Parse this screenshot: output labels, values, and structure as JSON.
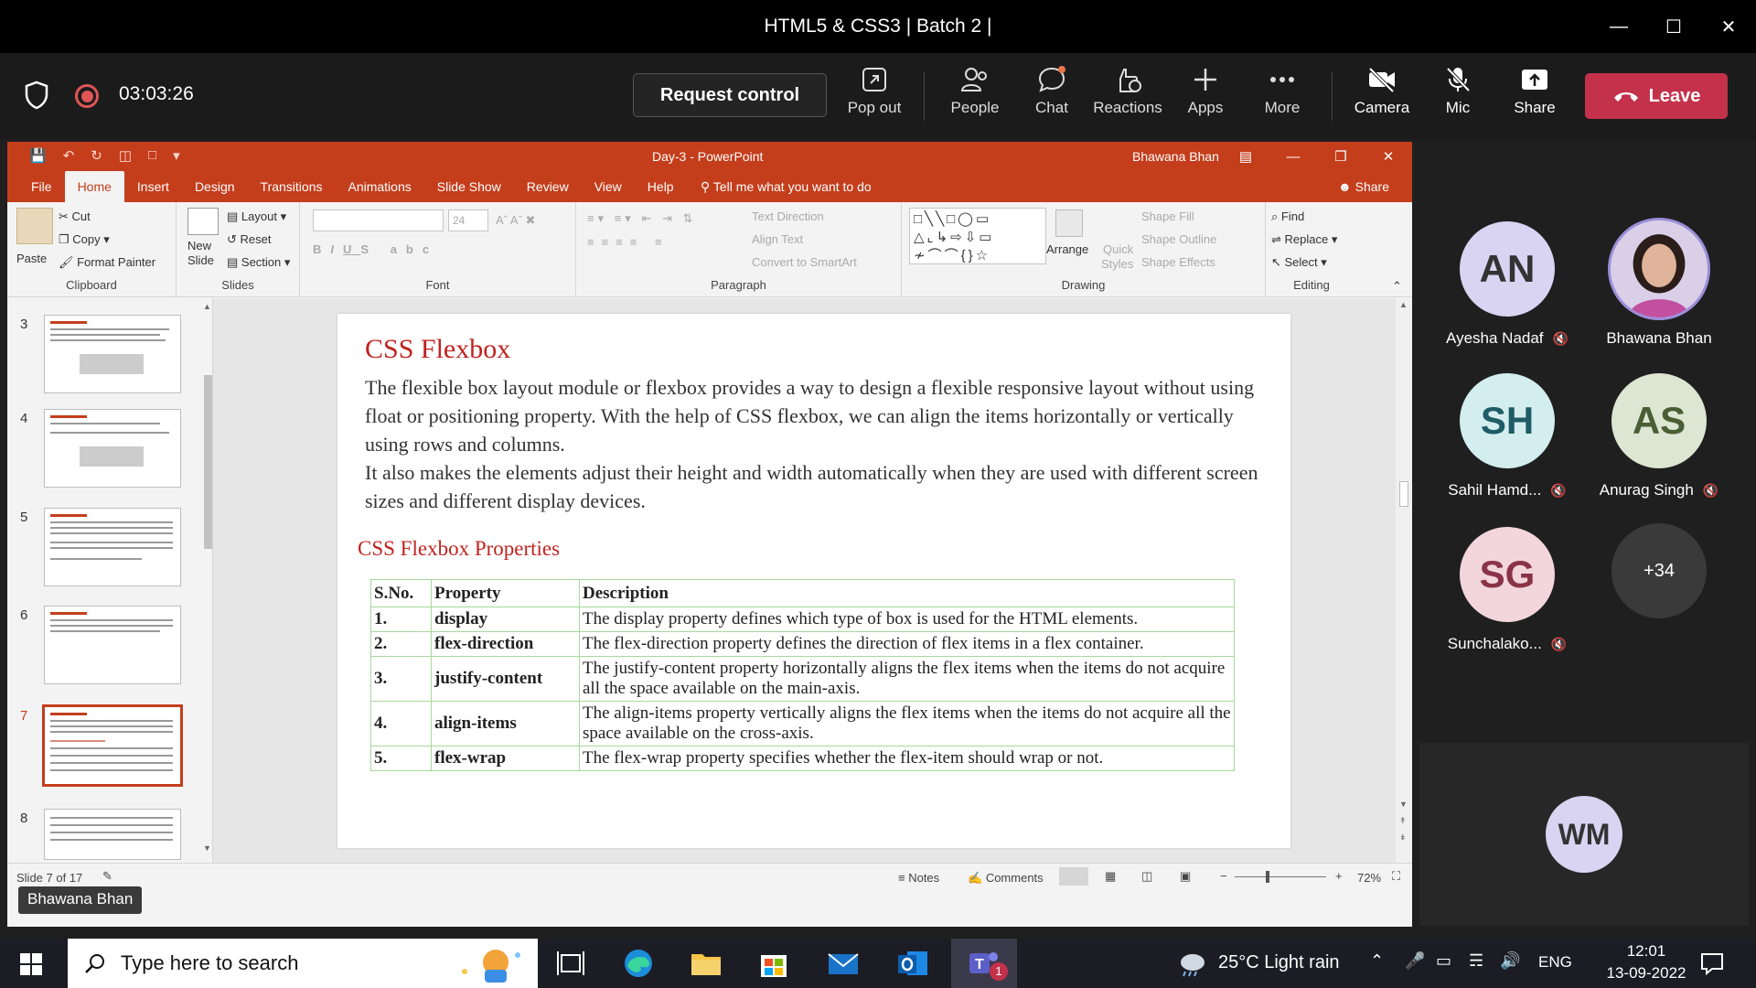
{
  "teams": {
    "window_title": "HTML5 & CSS3 | Batch 2 |",
    "timer": "03:03:26",
    "request_control": "Request control",
    "tools": [
      {
        "label": "Pop out",
        "icon": "pop-out-icon"
      },
      {
        "label": "People",
        "icon": "people-icon"
      },
      {
        "label": "Chat",
        "icon": "chat-icon"
      },
      {
        "label": "Reactions",
        "icon": "reactions-icon"
      },
      {
        "label": "Apps",
        "icon": "apps-icon"
      },
      {
        "label": "More",
        "icon": "more-icon"
      },
      {
        "label": "Camera",
        "icon": "camera-off-icon"
      },
      {
        "label": "Mic",
        "icon": "mic-off-icon"
      },
      {
        "label": "Share",
        "icon": "share-icon"
      }
    ],
    "leave": "Leave",
    "colors": {
      "leave": "#c4314b",
      "recording": "#e05555"
    }
  },
  "ppt": {
    "title": "Day-3 - PowerPoint",
    "user": "Bhawana Bhan",
    "tabs": [
      "File",
      "Home",
      "Insert",
      "Design",
      "Transitions",
      "Animations",
      "Slide Show",
      "Review",
      "View",
      "Help"
    ],
    "tell_me": "Tell me what you want to do",
    "share": "Share",
    "ribbon": {
      "clipboard": {
        "paste": "Paste",
        "cut": "Cut",
        "copy": "Copy",
        "format_painter": "Format Painter",
        "label": "Clipboard"
      },
      "slides": {
        "new_slide_1": "New",
        "new_slide_2": "Slide",
        "layout": "Layout",
        "reset": "Reset",
        "section": "Section",
        "label": "Slides"
      },
      "font": {
        "size": "24",
        "label": "Font"
      },
      "paragraph": {
        "text_direction": "Text Direction",
        "align_text": "Align Text",
        "convert": "Convert to SmartArt",
        "label": "Paragraph"
      },
      "drawing": {
        "arrange": "Arrange",
        "quick_styles_1": "Quick",
        "quick_styles_2": "Styles",
        "shape_fill": "Shape Fill",
        "shape_outline": "Shape Outline",
        "shape_effects": "Shape Effects",
        "label": "Drawing"
      },
      "editing": {
        "find": "Find",
        "replace": "Replace",
        "select": "Select",
        "label": "Editing"
      }
    },
    "thumb_numbers": [
      "3",
      "4",
      "5",
      "6",
      "7",
      "8"
    ],
    "slide": {
      "title": "CSS Flexbox",
      "para1": "The flexible box layout module or flexbox provides a way to design a flexible responsive layout without using float or positioning property. With the help of CSS flexbox, we can align the items horizontally or vertically using rows and columns.",
      "para2": "It also makes the elements adjust their height and width automatically when they are used with different screen sizes and different display devices.",
      "subtitle": "CSS Flexbox Properties",
      "table_headers": [
        "S.No.",
        "Property",
        "Description"
      ],
      "rows": [
        [
          "1.",
          "display",
          "The display property defines which type of box is used for the HTML elements."
        ],
        [
          "2.",
          "flex-direction",
          "The flex-direction property defines the direction of flex items in a flex container."
        ],
        [
          "3.",
          "justify-content",
          "The justify-content property horizontally aligns the flex items when the items do not acquire all the space available on the main-axis."
        ],
        [
          "4.",
          "align-items",
          "The align-items property vertically aligns the flex items when the items do not acquire all the space available on the cross-axis."
        ],
        [
          "5.",
          "flex-wrap",
          "The flex-wrap property specifies whether the flex-item should wrap or not."
        ]
      ]
    },
    "status": {
      "slide_of": "Slide 7 of 17",
      "notes": "Notes",
      "comments": "Comments",
      "zoom": "72%"
    },
    "presenter_label": "Bhawana Bhan",
    "theme_color": "#c43e1c"
  },
  "participants": [
    {
      "initials": "AN",
      "name": "Ayesha Nadaf",
      "muted": true,
      "color": "#d9d4f2"
    },
    {
      "initials": "",
      "name": "Bhawana Bhan",
      "muted": false,
      "color": "#c9b9e8"
    },
    {
      "initials": "SH",
      "name": "Sahil Hamd...",
      "muted": true,
      "color": "#d4eef0"
    },
    {
      "initials": "AS",
      "name": "Anurag Singh",
      "muted": true,
      "color": "#dde6d2"
    },
    {
      "initials": "SG",
      "name": "Sunchalako...",
      "muted": true,
      "color": "#f2d6dc"
    },
    {
      "initials": "+34",
      "name": "",
      "muted": false,
      "color": "#3a3a3a"
    }
  ],
  "stage_avatar": {
    "initials": "WM",
    "color": "#d9d4f2"
  },
  "taskbar": {
    "search_placeholder": "Type here to search",
    "weather": "25°C  Light rain",
    "lang": "ENG",
    "time": "12:01",
    "date": "13-09-2022",
    "teams_badge": "1"
  }
}
